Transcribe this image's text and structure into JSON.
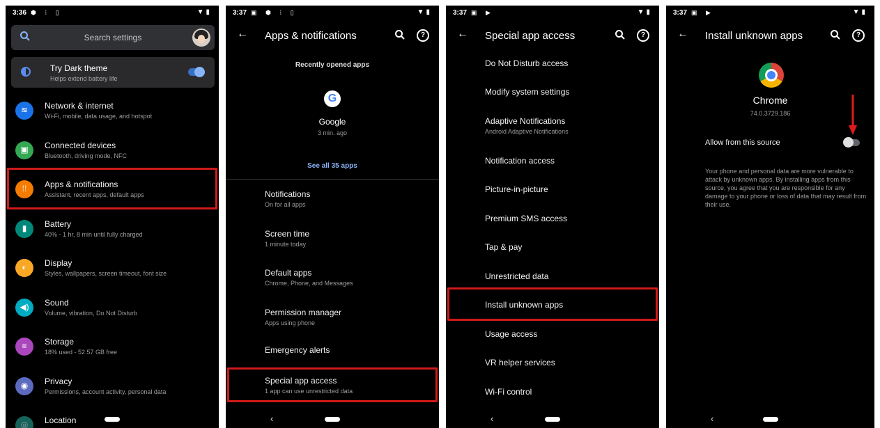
{
  "panel1": {
    "status": {
      "time": "3:36"
    },
    "search": {
      "placeholder": "Search settings"
    },
    "dark_theme": {
      "title": "Try Dark theme",
      "subtitle": "Helps extend battery life",
      "enabled": true
    },
    "items": [
      {
        "title": "Network & internet",
        "subtitle": "Wi-Fi, mobile, data usage, and hotspot",
        "icon": "wifi-icon",
        "color": "#1a73e8"
      },
      {
        "title": "Connected devices",
        "subtitle": "Bluetooth, driving mode, NFC",
        "icon": "connected-devices-icon",
        "color": "#34a853"
      },
      {
        "title": "Apps & notifications",
        "subtitle": "Assistant, recent apps, default apps",
        "icon": "apps-icon",
        "color": "#f57c00"
      },
      {
        "title": "Battery",
        "subtitle": "40% - 1 hr, 8 min until fully charged",
        "icon": "battery-icon",
        "color": "#00897b"
      },
      {
        "title": "Display",
        "subtitle": "Styles, wallpapers, screen timeout, font size",
        "icon": "display-icon",
        "color": "#f9a825"
      },
      {
        "title": "Sound",
        "subtitle": "Volume, vibration, Do Not Disturb",
        "icon": "sound-icon",
        "color": "#00acc1"
      },
      {
        "title": "Storage",
        "subtitle": "18% used - 52.57 GB free",
        "icon": "storage-icon",
        "color": "#ab47bc"
      },
      {
        "title": "Privacy",
        "subtitle": "Permissions, account activity, personal data",
        "icon": "privacy-icon",
        "color": "#5c6bc0"
      },
      {
        "title": "Location",
        "subtitle": "",
        "icon": "location-icon",
        "color": "#26a69a"
      }
    ]
  },
  "panel2": {
    "status": {
      "time": "3:37"
    },
    "title": "Apps & notifications",
    "recent_heading": "Recently opened apps",
    "recent_app": {
      "name": "Google",
      "time": "3 min. ago"
    },
    "see_all": "See all 35 apps",
    "items": [
      {
        "title": "Notifications",
        "subtitle": "On for all apps"
      },
      {
        "title": "Screen time",
        "subtitle": "1 minute today"
      },
      {
        "title": "Default apps",
        "subtitle": "Chrome, Phone, and Messages"
      },
      {
        "title": "Permission manager",
        "subtitle": "Apps using phone"
      },
      {
        "title": "Emergency alerts",
        "subtitle": ""
      },
      {
        "title": "Special app access",
        "subtitle": "1 app can use unrestricted data"
      }
    ]
  },
  "panel3": {
    "status": {
      "time": "3:37"
    },
    "title": "Special app access",
    "items": [
      {
        "title": "Do Not Disturb access"
      },
      {
        "title": "Modify system settings"
      },
      {
        "title": "Adaptive Notifications",
        "subtitle": "Android Adaptive Notifications"
      },
      {
        "title": "Notification access"
      },
      {
        "title": "Picture-in-picture"
      },
      {
        "title": "Premium SMS access"
      },
      {
        "title": "Tap & pay"
      },
      {
        "title": "Unrestricted data"
      },
      {
        "title": "Install unknown apps"
      },
      {
        "title": "Usage access"
      },
      {
        "title": "VR helper services"
      },
      {
        "title": "Wi-Fi control"
      }
    ]
  },
  "panel4": {
    "status": {
      "time": "3:37"
    },
    "title": "Install unknown apps",
    "app_name": "Chrome",
    "app_version": "74.0.3729.186",
    "allow_label": "Allow from this source",
    "allow_enabled": false,
    "warning": "Your phone and personal data are more vulnerable to attack by unknown apps. By installing apps from this source, you agree that you are responsible for any damage to your phone or loss of data that may result from their use."
  },
  "colors": {
    "highlight": "#d11a1a",
    "accent": "#8ab4f8"
  }
}
